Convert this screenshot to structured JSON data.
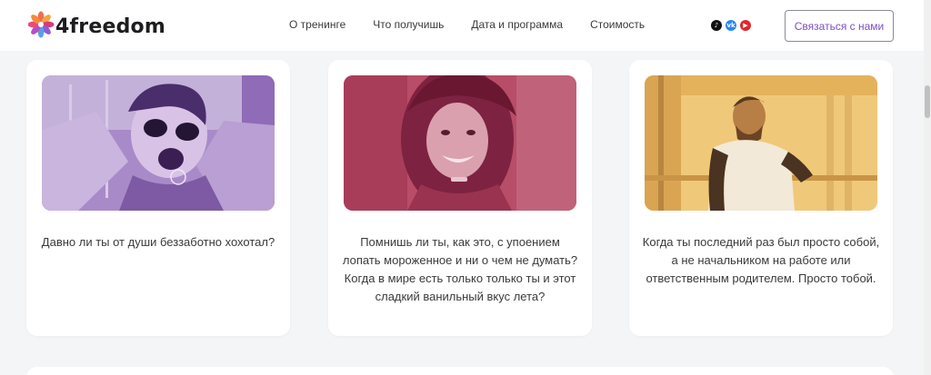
{
  "header": {
    "logo_text": "4freedom",
    "nav": [
      "О тренинге",
      "Что получишь",
      "Дата и программа",
      "Стоимость"
    ],
    "socials": [
      "tiktok-icon",
      "vk-icon",
      "youtube-icon"
    ],
    "contact_label": "Связаться с нами"
  },
  "cards": [
    {
      "photo": "laughing-woman-sunglasses",
      "tint": "#9b6fc7",
      "text": "Давно ли ты от души беззаботно хохотал?"
    },
    {
      "photo": "smiling-woman-ice-cream",
      "tint": "#b5405e",
      "text": "Помнишь ли ты, как это, с упоением лопать мороженное и ни о чем не думать? Когда в мире есть только только ты и этот сладкий ванильный вкус лета?"
    },
    {
      "photo": "smiling-man-sitting",
      "tint": "#e8b75c",
      "text": "Когда ты последний раз был просто собой, а не начальником на работе или ответственным родителем. Просто тобой."
    }
  ]
}
